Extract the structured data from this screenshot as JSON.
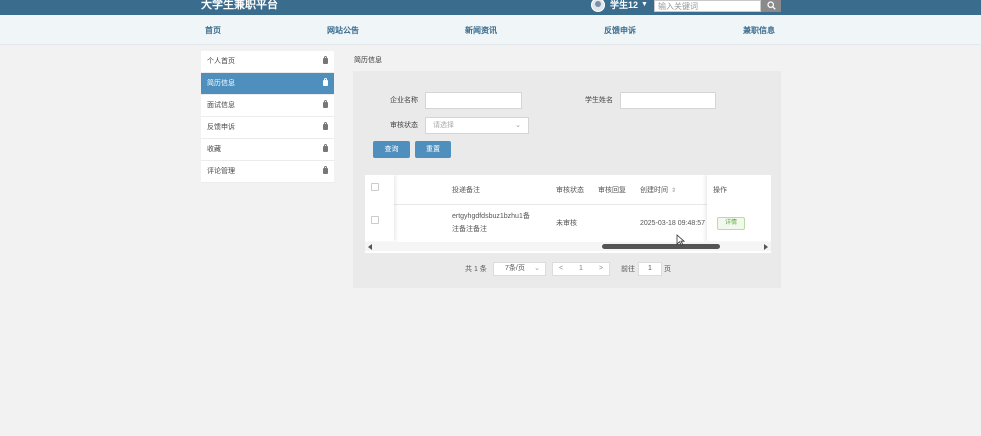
{
  "header": {
    "site_title": "大学生兼职平台",
    "username": "学生12",
    "search_placeholder": "输入关键词",
    "brand_color": "#3a6c8e"
  },
  "nav": {
    "items": [
      {
        "label": "首页"
      },
      {
        "label": "网站公告"
      },
      {
        "label": "新闻资讯"
      },
      {
        "label": "反馈申诉"
      },
      {
        "label": "兼职信息"
      }
    ]
  },
  "sidebar": {
    "items": [
      {
        "label": "个人首页",
        "active": false
      },
      {
        "label": "简历信息",
        "active": true
      },
      {
        "label": "面试信息",
        "active": false
      },
      {
        "label": "反馈申诉",
        "active": false
      },
      {
        "label": "收藏",
        "active": false
      },
      {
        "label": "评论管理",
        "active": false
      }
    ],
    "active_color": "#4f8fbd"
  },
  "page": {
    "section_title": "简历信息"
  },
  "filters": {
    "company_label": "企业名称",
    "company_value": "",
    "student_label": "学生姓名",
    "student_value": "",
    "status_label": "审核状态",
    "status_placeholder": "请选择",
    "query_button": "查询",
    "reset_button": "重置"
  },
  "table": {
    "headers": {
      "remark": "投递备注",
      "status": "审核状态",
      "reply": "审核回复",
      "created": "创建时间",
      "actions": "操作"
    },
    "rows": [
      {
        "remark_line1": "ertgyhgdfdsbuz1bzhu1备",
        "remark_line2": "注备注备注",
        "status": "未审核",
        "reply": "",
        "created": "2025-03-18 09:48:57",
        "detail_button": "详情"
      }
    ]
  },
  "pagination": {
    "total": "共 1 条",
    "page_size": "7条/页",
    "prev": "<",
    "current_page": "1",
    "next": ">",
    "goto_label": "前往",
    "goto_value": "1",
    "goto_suffix": "页"
  }
}
